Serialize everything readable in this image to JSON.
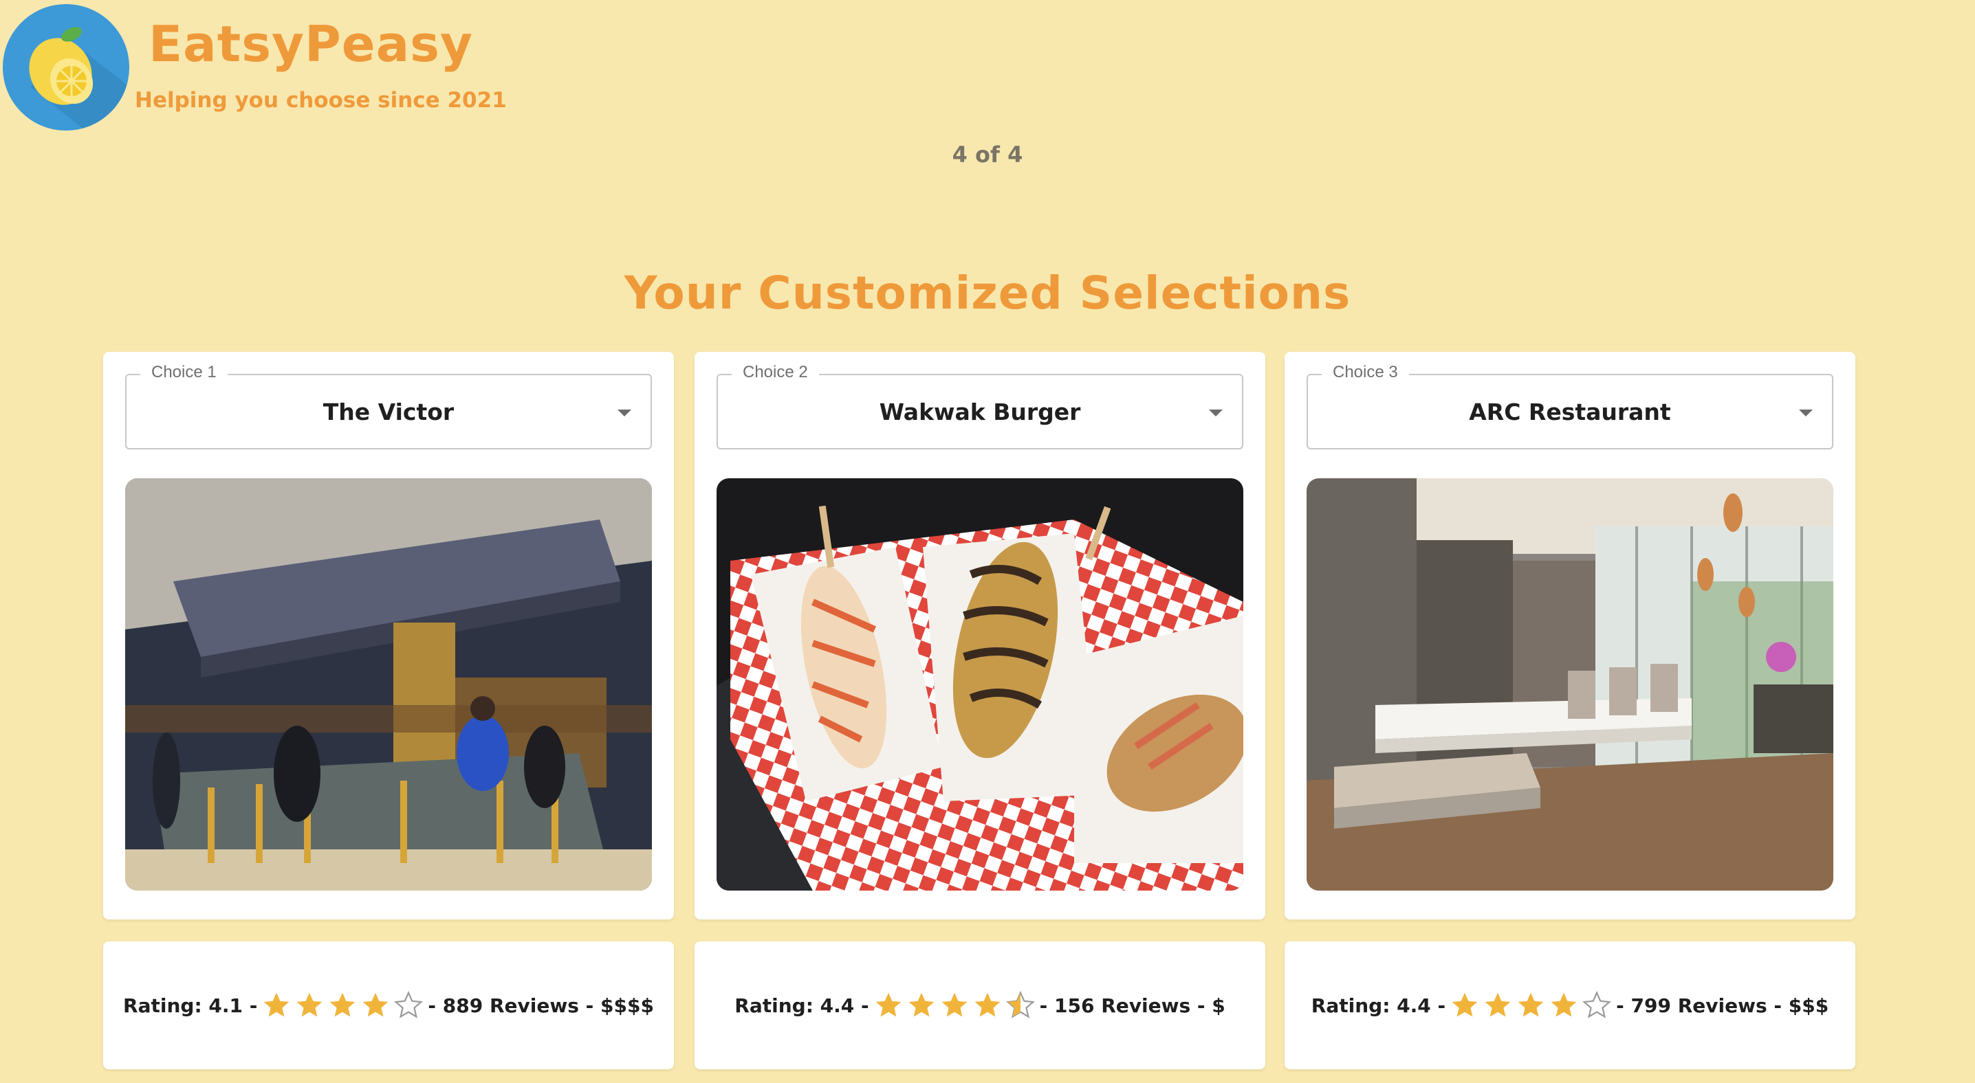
{
  "header": {
    "brand": "EatsyPeasy",
    "tagline": "Helping you choose since 2021",
    "logo_icon": "lemon-icon"
  },
  "progress_text": "4 of 4",
  "section_title": "Your Customized Selections",
  "choices": [
    {
      "label": "Choice 1",
      "selected": "The Victor",
      "photo": "restaurant-bar-interior",
      "rating_prefix": "Rating: 4.1 -",
      "rating_value": 4.1,
      "stars_shown": 4,
      "star_half": false,
      "rating_suffix": "- 889 Reviews - $$$$"
    },
    {
      "label": "Choice 2",
      "selected": "Wakwak Burger",
      "photo": "corn-dogs-on-checkered-paper",
      "rating_prefix": "Rating: 4.4 -",
      "rating_value": 4.4,
      "stars_shown": 4,
      "star_half": true,
      "rating_suffix": "- 156 Reviews - $"
    },
    {
      "label": "Choice 3",
      "selected": "ARC Restaurant",
      "photo": "modern-dining-room",
      "rating_prefix": "Rating: 4.4 -",
      "rating_value": 4.4,
      "stars_shown": 4,
      "star_half": false,
      "rating_suffix": "- 799 Reviews - $$$"
    }
  ],
  "colors": {
    "background": "#f8e8ae",
    "accent": "#ef9a3a",
    "star": "#f1b43b",
    "logo_bg": "#3d9ad6"
  }
}
